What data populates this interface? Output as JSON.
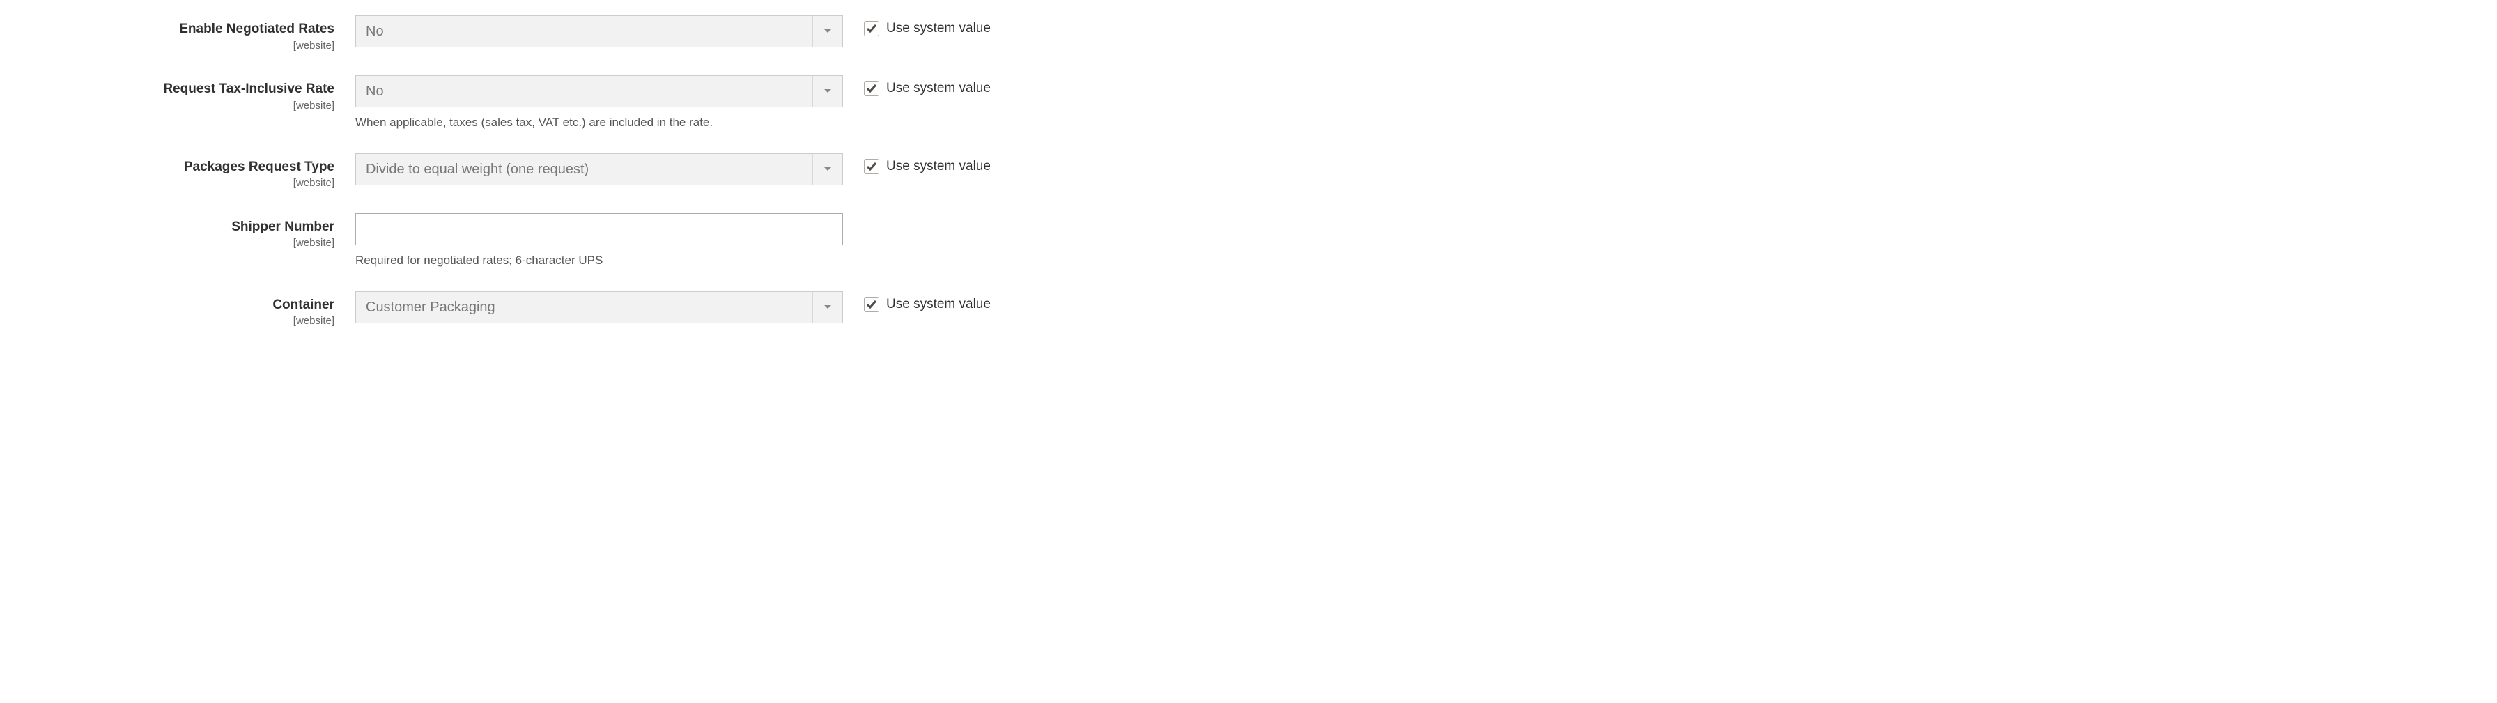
{
  "fields": {
    "negotiated_rates": {
      "label": "Enable Negotiated Rates",
      "scope": "[website]",
      "value": "No",
      "use_system": true,
      "use_system_label": "Use system value"
    },
    "tax_inclusive": {
      "label": "Request Tax-Inclusive Rate",
      "scope": "[website]",
      "value": "No",
      "hint": "When applicable, taxes (sales tax, VAT etc.) are included in the rate.",
      "use_system": true,
      "use_system_label": "Use system value"
    },
    "packages_request": {
      "label": "Packages Request Type",
      "scope": "[website]",
      "value": "Divide to equal weight (one request)",
      "use_system": true,
      "use_system_label": "Use system value"
    },
    "shipper_number": {
      "label": "Shipper Number",
      "scope": "[website]",
      "value": "",
      "hint": "Required for negotiated rates; 6-character UPS"
    },
    "container": {
      "label": "Container",
      "scope": "[website]",
      "value": "Customer Packaging",
      "use_system": true,
      "use_system_label": "Use system value"
    }
  }
}
